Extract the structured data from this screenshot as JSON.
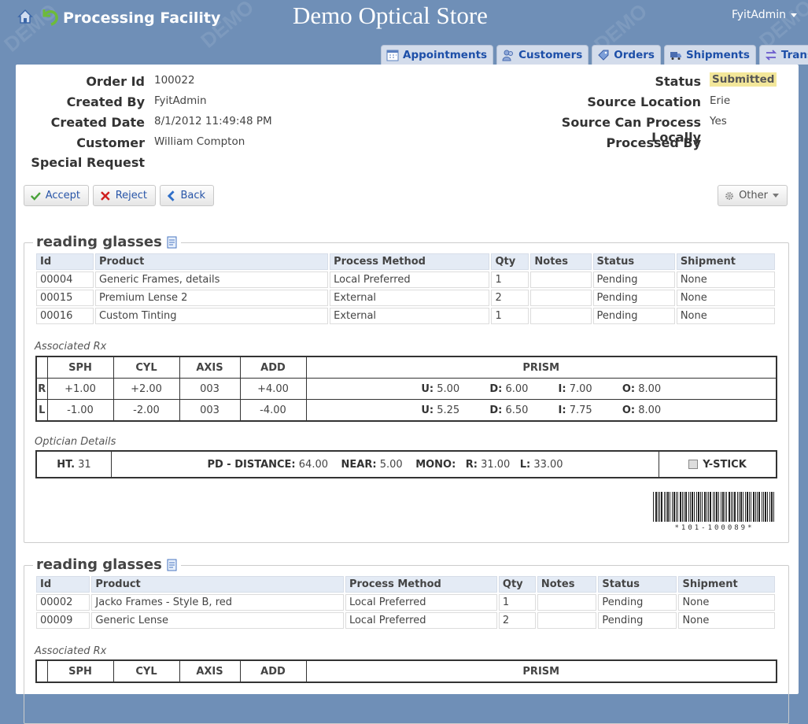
{
  "header": {
    "facility_title": "Processing Facility",
    "store_title": "Demo Optical Store",
    "user_name": "FyitAdmin",
    "watermark": "DEMO"
  },
  "tabs": [
    {
      "label": "Appointments",
      "icon": "calendar-icon"
    },
    {
      "label": "Customers",
      "icon": "users-icon"
    },
    {
      "label": "Orders",
      "icon": "tag-icon"
    },
    {
      "label": "Shipments",
      "icon": "truck-icon"
    },
    {
      "label": "Transfers",
      "icon": "transfer-icon"
    }
  ],
  "order": {
    "labels": {
      "order_id": "Order Id",
      "created_by": "Created By",
      "created_date": "Created Date",
      "customer": "Customer",
      "special_request": "Special Request",
      "status": "Status",
      "source_location": "Source Location",
      "source_can_process": "Source Can Process Locally",
      "processed_by": "Processed By"
    },
    "order_id": "100022",
    "created_by": "FyitAdmin",
    "created_date": "8/1/2012 11:49:48 PM",
    "customer": "William Compton",
    "special_request": "",
    "status": "Submitted",
    "source_location": "Erie",
    "source_can_process": "Yes",
    "processed_by": ""
  },
  "actions": {
    "accept": "Accept",
    "reject": "Reject",
    "back": "Back",
    "other": "Other"
  },
  "columns": [
    "Id",
    "Product",
    "Process Method",
    "Qty",
    "Notes",
    "Status",
    "Shipment"
  ],
  "sections": [
    {
      "title": "reading glasses",
      "items": [
        {
          "id": "00004",
          "product": "Generic Frames, details",
          "method": "Local Preferred",
          "qty": "1",
          "notes": "",
          "status": "Pending",
          "shipment": "None"
        },
        {
          "id": "00015",
          "product": "Premium Lense 2",
          "method": "External",
          "qty": "2",
          "notes": "",
          "status": "Pending",
          "shipment": "None"
        },
        {
          "id": "00016",
          "product": "Custom Tinting",
          "method": "External",
          "qty": "1",
          "notes": "",
          "status": "Pending",
          "shipment": "None"
        }
      ],
      "rx_label": "Associated Rx",
      "rx_headers": [
        "SPH",
        "CYL",
        "AXIS",
        "ADD",
        "PRISM"
      ],
      "rx": [
        {
          "eye": "R",
          "sph": "+1.00",
          "cyl": "+2.00",
          "axis": "003",
          "add": "+4.00",
          "u": "5.00",
          "d": "6.00",
          "i": "7.00",
          "o": "8.00"
        },
        {
          "eye": "L",
          "sph": "-1.00",
          "cyl": "-2.00",
          "axis": "003",
          "add": "-4.00",
          "u": "5.25",
          "d": "6.50",
          "i": "7.75",
          "o": "8.00"
        }
      ],
      "prism_labels": {
        "u": "U:",
        "d": "D:",
        "i": "I:",
        "o": "O:"
      },
      "optician_label": "Optician Details",
      "optician": {
        "ht_label": "HT.",
        "ht": "31",
        "pd_label": "PD - DISTANCE:",
        "pd": "64.00",
        "near_label": "NEAR:",
        "near": "5.00",
        "mono_label": "MONO:",
        "r_label": "R:",
        "r": "31.00",
        "l_label": "L:",
        "l": "33.00",
        "ystick_label": "Y-STICK"
      },
      "barcode_text": "*101-100089*"
    },
    {
      "title": "reading glasses",
      "items": [
        {
          "id": "00002",
          "product": "Jacko Frames - Style B, red",
          "method": "Local Preferred",
          "qty": "1",
          "notes": "",
          "status": "Pending",
          "shipment": "None"
        },
        {
          "id": "00009",
          "product": "Generic Lense",
          "method": "Local Preferred",
          "qty": "2",
          "notes": "",
          "status": "Pending",
          "shipment": "None"
        }
      ],
      "rx_label": "Associated Rx",
      "rx_headers": [
        "SPH",
        "CYL",
        "AXIS",
        "ADD",
        "PRISM"
      ]
    }
  ],
  "colors": {
    "background": "#6f8fb7",
    "tab_bg": "#d3dceb",
    "link": "#1d4fa8",
    "status_badge": "#f3e79a"
  }
}
